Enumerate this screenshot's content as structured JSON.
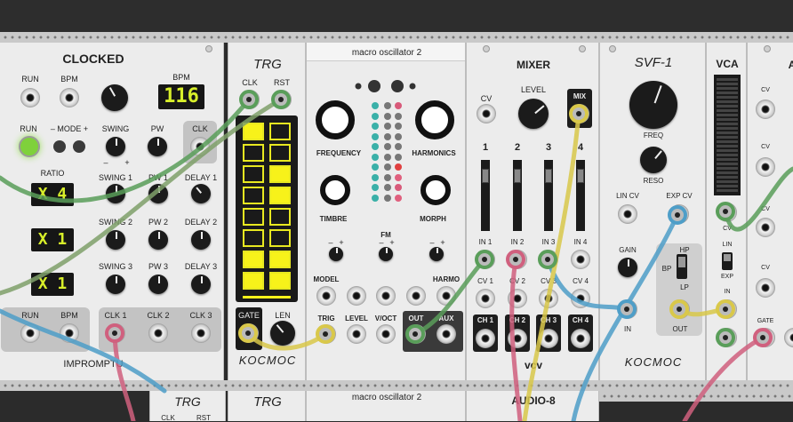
{
  "clocked": {
    "title": "CLOCKED",
    "labels": {
      "run": "RUN",
      "bpm": "BPM",
      "bpm_display_label": "BPM",
      "run_btn": "RUN",
      "mode": "– MODE +",
      "swing": "SWING",
      "pw": "PW",
      "clk": "CLK",
      "ratio": "RATIO",
      "swing1": "SWING 1",
      "pw1": "PW 1",
      "delay1": "DELAY 1",
      "swing2": "SWING 2",
      "pw2": "PW 2",
      "delay2": "DELAY 2",
      "swing3": "SWING 3",
      "pw3": "PW 3",
      "delay3": "DELAY 3",
      "run_out": "RUN",
      "bpm_out": "BPM",
      "clk1": "CLK 1",
      "clk2": "CLK 2",
      "clk3": "CLK 3",
      "swing_minus": "–",
      "swing_plus": "+"
    },
    "bpm_value": "116",
    "ratios": [
      "X 4",
      "X 1",
      "X 1"
    ],
    "brand": "IMPROMPTU"
  },
  "trg": {
    "title": "TRG",
    "labels": {
      "clk": "CLK",
      "rst": "RST",
      "gate": "GATE",
      "len": "LEN"
    },
    "brand": "KOCMOC",
    "grid_left": [
      1,
      0,
      0,
      0,
      0,
      0,
      1,
      1
    ],
    "grid_right": [
      0,
      0,
      1,
      1,
      0,
      0,
      1,
      1
    ]
  },
  "macro": {
    "title": "macro oscillator 2",
    "labels": {
      "frequency": "FREQUENCY",
      "harmonics": "HARMONICS",
      "timbre": "TIMBRE",
      "morph": "MORPH",
      "fm": "FM",
      "model": "MODEL",
      "harmo": "HARMO",
      "trig": "TRIG",
      "level": "LEVEL",
      "voct": "V/OCT",
      "out": "OUT",
      "aux": "AUX",
      "minus": "–",
      "plus": "+"
    }
  },
  "mixer": {
    "title": "MIXER",
    "labels": {
      "cv": "CV",
      "level": "LEVEL",
      "mix": "MIX",
      "ch1": "1",
      "ch2": "2",
      "ch3": "3",
      "ch4": "4",
      "in1": "IN 1",
      "in2": "IN 2",
      "in3": "IN 3",
      "in4": "IN 4",
      "cv1": "CV 1",
      "cv2": "CV 2",
      "cv3": "CV 3",
      "cv4": "CV 4",
      "out1": "CH 1",
      "out2": "CH 2",
      "out3": "CH 3",
      "out4": "CH 4"
    },
    "brand": "vcv"
  },
  "svf": {
    "title": "SVF-1",
    "labels": {
      "freq": "FREQ",
      "reso": "RESO",
      "lin_cv": "LIN CV",
      "exp_cv": "EXP CV",
      "gain": "GAIN",
      "in": "IN",
      "hp": "HP",
      "bp": "BP",
      "lp": "LP",
      "out": "OUT"
    },
    "brand": "KOCMOC"
  },
  "vca": {
    "title": "VCA",
    "labels": {
      "cv": "CV",
      "lin": "LIN",
      "exp": "EXP",
      "in": "IN"
    }
  },
  "partial": {
    "title_fragment": "A",
    "labels": {
      "cv1": "CV",
      "cv2": "CV",
      "cv3": "CV",
      "cv4": "CV",
      "gate": "GATE"
    }
  },
  "row2": {
    "trg_small": "TRG",
    "trg_small_clk": "CLK",
    "trg_small_rst": "RST",
    "trg": "TRG",
    "macro": "macro oscillator 2",
    "audio8": "AUDIO-8"
  },
  "cable_colors": {
    "green": "#5a9e5a",
    "pink": "#d0607e",
    "blue": "#4e9ec8",
    "yellow": "#d9c84a",
    "olive": "#7fa06a"
  }
}
